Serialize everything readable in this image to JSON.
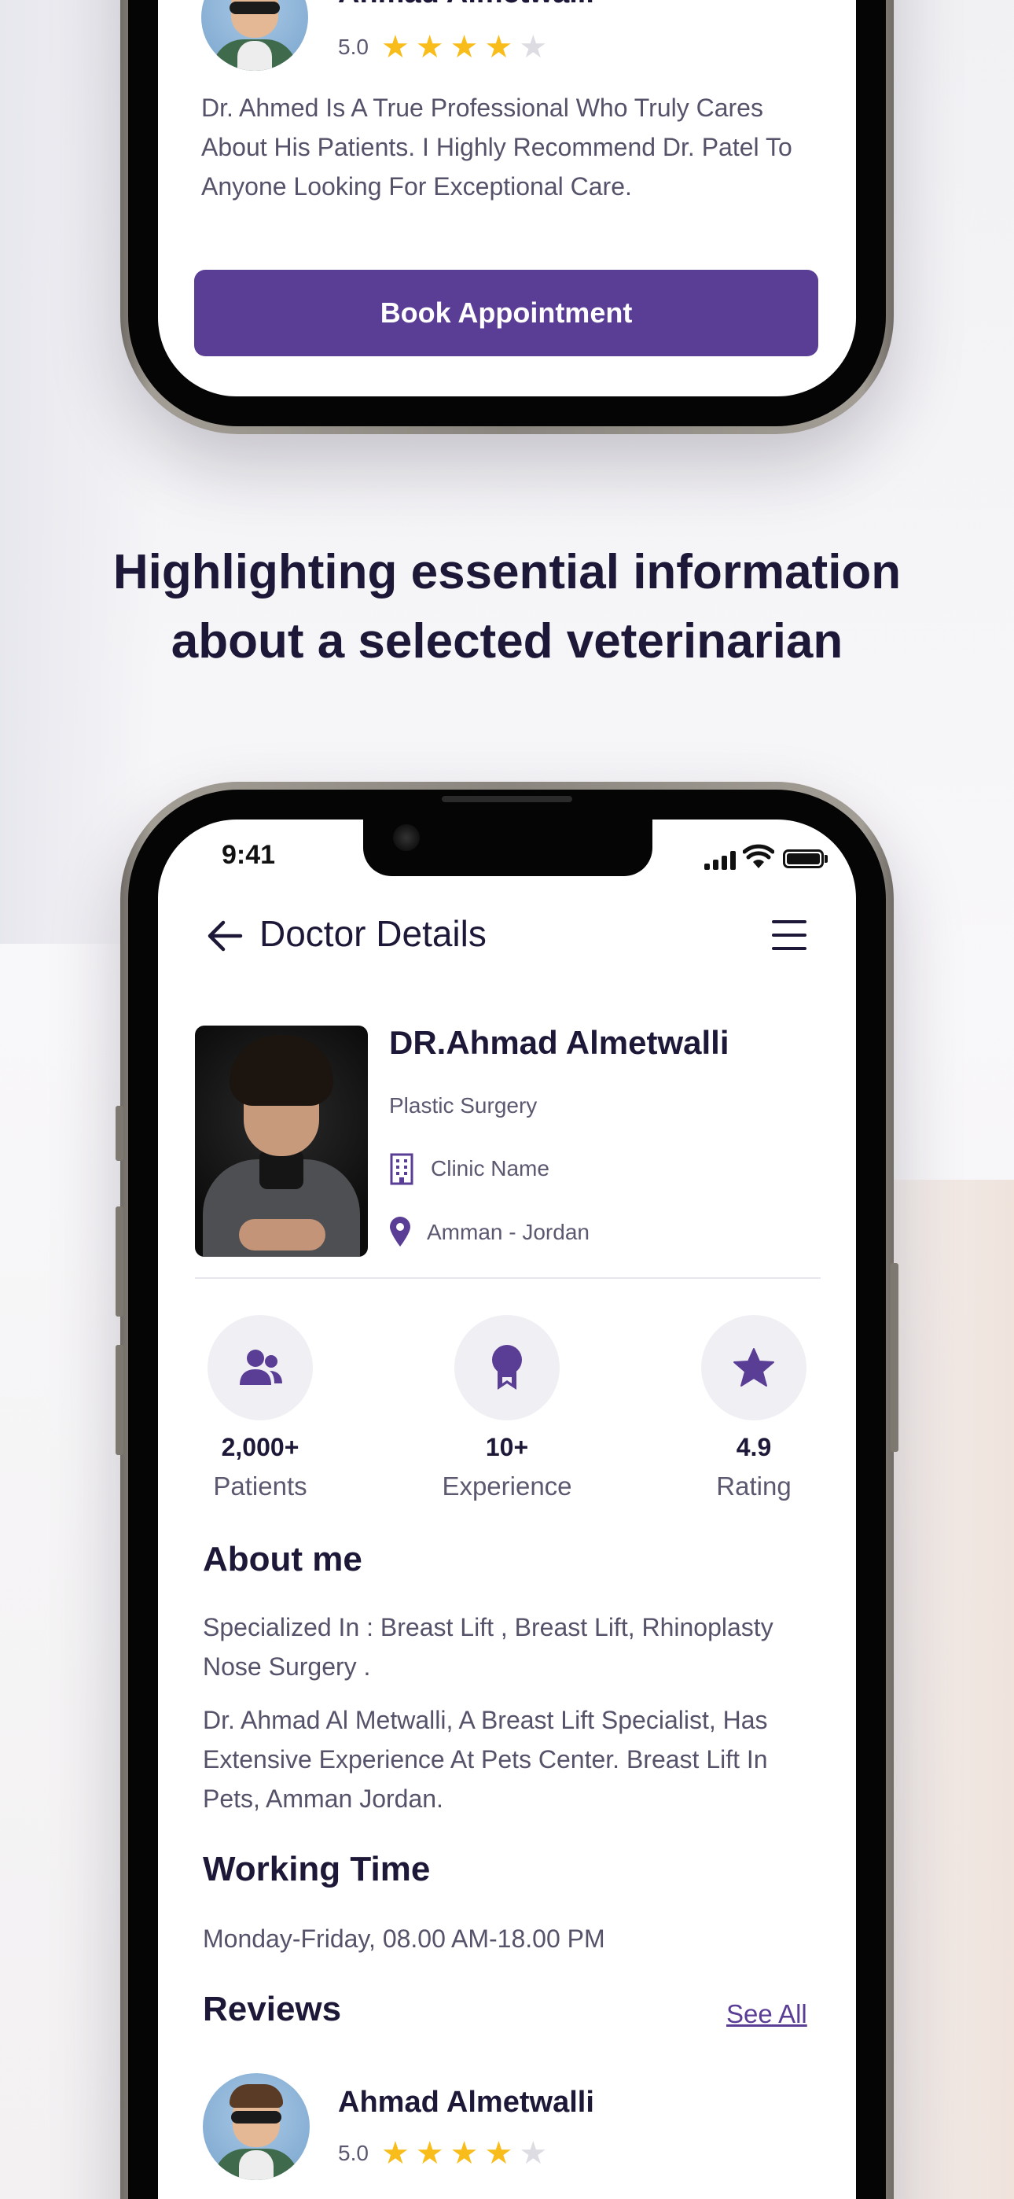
{
  "headline": {
    "line1": "Highlighting essential information",
    "line2": "about a selected veterinarian"
  },
  "top_phone": {
    "reviewer_name": "Ahmad Almetwalli",
    "rating": "5.0",
    "stars_filled": 4,
    "stars_total": 5,
    "review_text": "Dr. Ahmed Is A True Professional Who Truly Cares About His Patients. I Highly Recommend Dr. Patel To Anyone Looking For Exceptional Care.",
    "book_button": "Book Appointment"
  },
  "status_bar": {
    "time": "9:41"
  },
  "header": {
    "title": "Doctor Details"
  },
  "doctor": {
    "name": "DR.Ahmad Almetwalli",
    "specialty": "Plastic Surgery",
    "clinic": "Clinic Name",
    "location": "Amman - Jordan"
  },
  "stats": [
    {
      "value": "2,000+",
      "label": "Patients",
      "icon": "patients-icon"
    },
    {
      "value": "10+",
      "label": "Experience",
      "icon": "award-icon"
    },
    {
      "value": "4.9",
      "label": "Rating",
      "icon": "star-icon"
    }
  ],
  "about": {
    "title": "About me",
    "specialized": "Specialized In : Breast Lift , Breast Lift, Rhinoplasty Nose Surgery .",
    "description": "Dr. Ahmad Al Metwalli, A Breast Lift Specialist, Has Extensive Experience At Pets Center. Breast Lift In Pets, Amman Jordan."
  },
  "working_time": {
    "title": "Working Time",
    "hours": "Monday-Friday, 08.00 AM-18.00 PM"
  },
  "reviews": {
    "title": "Reviews",
    "see_all": "See All",
    "first": {
      "name": "Ahmad Almetwalli",
      "rating": "5.0",
      "stars_filled": 4
    }
  },
  "colors": {
    "primary": "#5a3e96",
    "dark_text": "#1d1838",
    "star": "#f8bd1a"
  }
}
